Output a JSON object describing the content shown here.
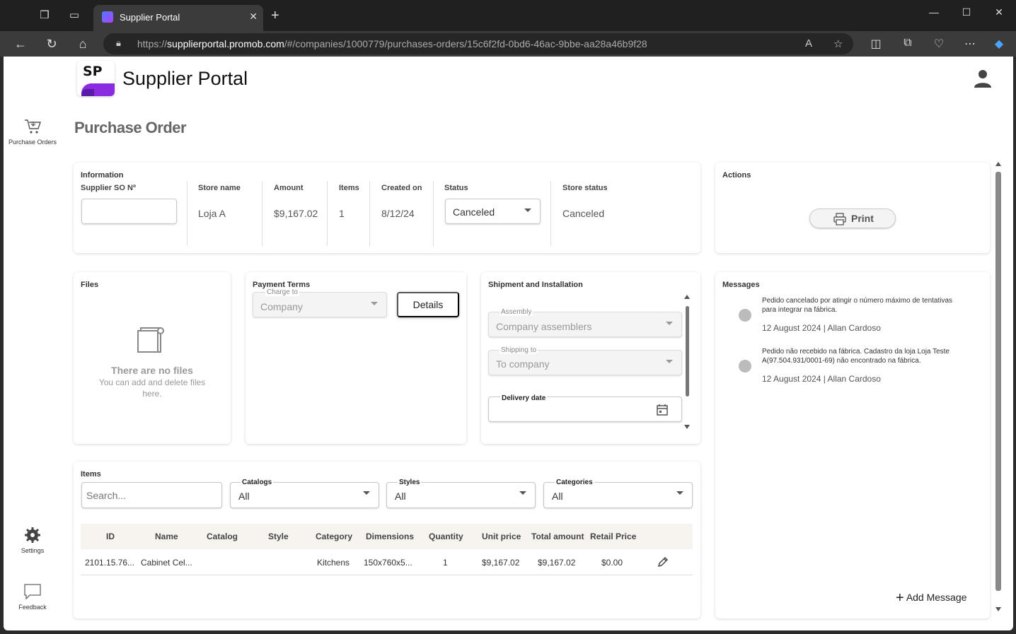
{
  "browser": {
    "tab_title": "Supplier Portal",
    "url_prefix": "https://",
    "url_host": "supplierportal.promob.com",
    "url_path": "/#/companies/1000779/purchases-orders/15c6f2fd-0bd6-46ac-9bbe-aa28a46b9f28"
  },
  "app": {
    "logo_text": "SP",
    "title": "Supplier Portal"
  },
  "sidebar": {
    "purchase_orders": "Purchase Orders",
    "settings": "Settings",
    "feedback": "Feedback"
  },
  "page": {
    "title": "Purchase Order"
  },
  "information": {
    "title": "Information",
    "supplier_so_label": "Supplier SO Nº",
    "supplier_so_value": "",
    "store_name_label": "Store name",
    "store_name": "Loja A",
    "amount_label": "Amount",
    "amount": "$9,167.02",
    "items_label": "Items",
    "items": "1",
    "created_label": "Created on",
    "created": "8/12/24",
    "status_label": "Status",
    "status": "Canceled",
    "store_status_label": "Store status",
    "store_status": "Canceled"
  },
  "actions": {
    "title": "Actions",
    "print": "Print"
  },
  "files": {
    "title": "Files",
    "empty_title": "There are no files",
    "empty_text": "You can add and delete files here."
  },
  "payment": {
    "title": "Payment Terms",
    "charge_label": "Charge to",
    "charge_value": "Company",
    "details": "Details"
  },
  "shipment": {
    "title": "Shipment and Installation",
    "assembly_label": "Assembly",
    "assembly_value": "Company assemblers",
    "shipping_label": "Shipping to",
    "shipping_value": "To company",
    "delivery_label": "Delivery date"
  },
  "messages": {
    "title": "Messages",
    "list": [
      {
        "text": "Pedido cancelado por atingir o número máximo de tentativas para integrar na fábrica.",
        "meta": "12 August 2024 | Allan Cardoso"
      },
      {
        "text": "Pedido não recebido na fábrica. Cadastro da loja Loja Teste A(97.504.931/0001-69) não encontrado na fábrica.",
        "meta": "12 August 2024 | Allan Cardoso"
      }
    ],
    "add": "Add Message"
  },
  "items": {
    "title": "Items",
    "search_placeholder": "Search...",
    "catalogs_label": "Catalogs",
    "catalogs_value": "All",
    "styles_label": "Styles",
    "styles_value": "All",
    "categories_label": "Categories",
    "categories_value": "All",
    "columns": [
      "ID",
      "Name",
      "Catalog",
      "Style",
      "Category",
      "Dimensions",
      "Quantity",
      "Unit price",
      "Total amount",
      "Retail Price"
    ],
    "rows": [
      {
        "id": "2101.15.76...",
        "name": "Cabinet Cel...",
        "catalog": "",
        "style": "",
        "category": "Kitchens",
        "dimensions": "150x760x5...",
        "quantity": "1",
        "unit_price": "$9,167.02",
        "total": "$9,167.02",
        "retail": "$0.00"
      }
    ]
  }
}
